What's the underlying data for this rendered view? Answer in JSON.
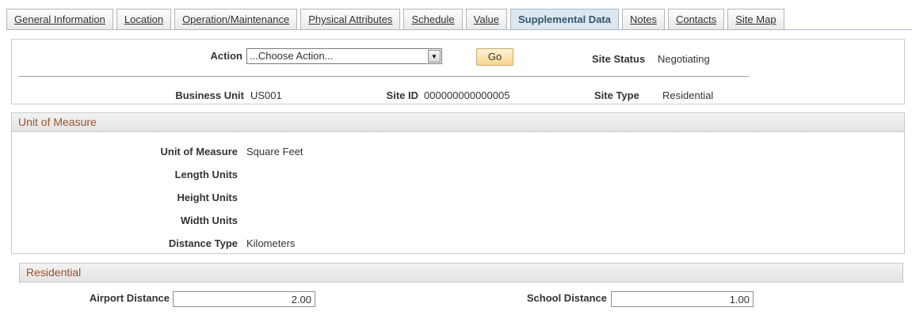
{
  "tabs": [
    {
      "label": "General Information"
    },
    {
      "label": "Location"
    },
    {
      "label": "Operation/Maintenance"
    },
    {
      "label": "Physical Attributes"
    },
    {
      "label": "Schedule"
    },
    {
      "label": "Value"
    },
    {
      "label": "Supplemental Data"
    },
    {
      "label": "Notes"
    },
    {
      "label": "Contacts"
    },
    {
      "label": "Site Map"
    }
  ],
  "header": {
    "action_label": "Action",
    "action_value": "...Choose Action...",
    "go_label": "Go",
    "site_status_label": "Site Status",
    "site_status_value": "Negotiating",
    "business_unit_label": "Business Unit",
    "business_unit_value": "US001",
    "site_id_label": "Site ID",
    "site_id_value": "000000000000005",
    "site_type_label": "Site Type",
    "site_type_value": "Residential"
  },
  "uom": {
    "title": "Unit of Measure",
    "unit_of_measure_label": "Unit of Measure",
    "unit_of_measure_value": "Square Feet",
    "length_units_label": "Length Units",
    "height_units_label": "Height Units",
    "width_units_label": "Width Units",
    "distance_type_label": "Distance Type",
    "distance_type_value": "Kilometers"
  },
  "residential": {
    "title": "Residential",
    "airport_distance_label": "Airport Distance",
    "airport_distance_value": "2.00",
    "school_distance_label": "School Distance",
    "school_distance_value": "1.00"
  },
  "colors": {
    "tab_active_bg": "#dce7f0",
    "section_title": "#a0512a",
    "go_button": "#f7d58f"
  }
}
